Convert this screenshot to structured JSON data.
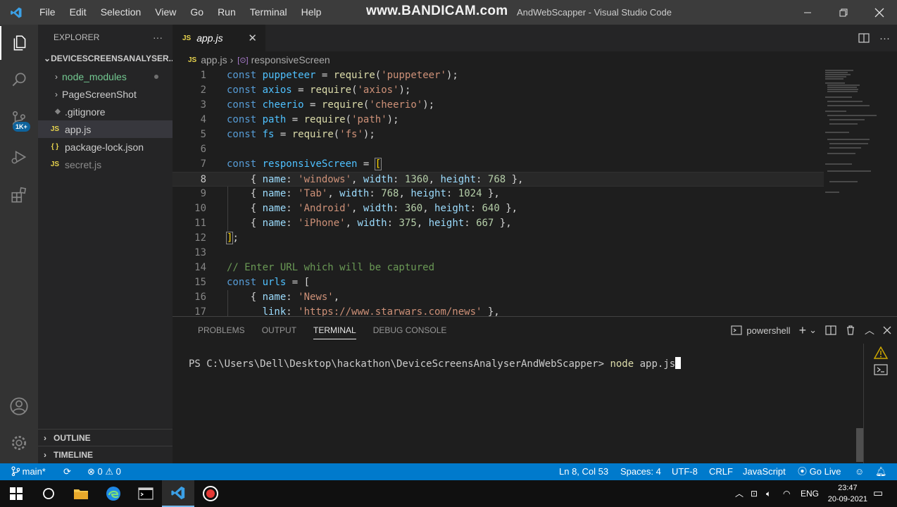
{
  "titlebar": {
    "menu": [
      "File",
      "Edit",
      "Selection",
      "View",
      "Go",
      "Run",
      "Terminal",
      "Help"
    ],
    "watermark": "www.BANDICAM.com",
    "title": "AndWebScapper - Visual Studio Code"
  },
  "activity": {
    "source_control_badge": "1K+"
  },
  "sidebar": {
    "header": "EXPLORER",
    "more": "···",
    "folder": "DEVICESCREENSANALYSER...",
    "items": [
      {
        "label": "node_modules",
        "type": "folder"
      },
      {
        "label": "PageScreenShot",
        "type": "folder"
      },
      {
        "label": ".gitignore",
        "type": "file"
      },
      {
        "label": "app.js",
        "type": "js"
      },
      {
        "label": "package-lock.json",
        "type": "json"
      },
      {
        "label": "secret.js",
        "type": "js"
      }
    ],
    "outline": "OUTLINE",
    "timeline": "TIMELINE"
  },
  "editor": {
    "tab_label": "app.js",
    "tab_icon": "JS",
    "breadcrumb_file": "app.js",
    "breadcrumb_symbol": "responsiveScreen",
    "line_numbers": [
      "1",
      "2",
      "3",
      "4",
      "5",
      "6",
      "7",
      "8",
      "9",
      "10",
      "11",
      "12",
      "13",
      "14",
      "15",
      "16",
      "17"
    ]
  },
  "panel": {
    "tabs": [
      "PROBLEMS",
      "OUTPUT",
      "TERMINAL",
      "DEBUG CONSOLE"
    ],
    "shell": "powershell",
    "prompt": "PS C:\\Users\\Dell\\Desktop\\hackathon\\DeviceScreensAnalyserAndWebScapper> ",
    "command_node": "node",
    "command_arg": " app.js"
  },
  "statusbar": {
    "branch": "main*",
    "errors": "0",
    "warnings": "0",
    "position": "Ln 8, Col 53",
    "spaces": "Spaces: 4",
    "encoding": "UTF-8",
    "eol": "CRLF",
    "language": "JavaScript",
    "golive": "Go Live"
  },
  "taskbar": {
    "lang": "ENG",
    "time": "23:47",
    "date": "20-09-2021"
  },
  "colors": {
    "accent": "#007acc",
    "titlebar": "#3c3c3c",
    "sidebar": "#252526",
    "editor": "#1e1e1e"
  }
}
